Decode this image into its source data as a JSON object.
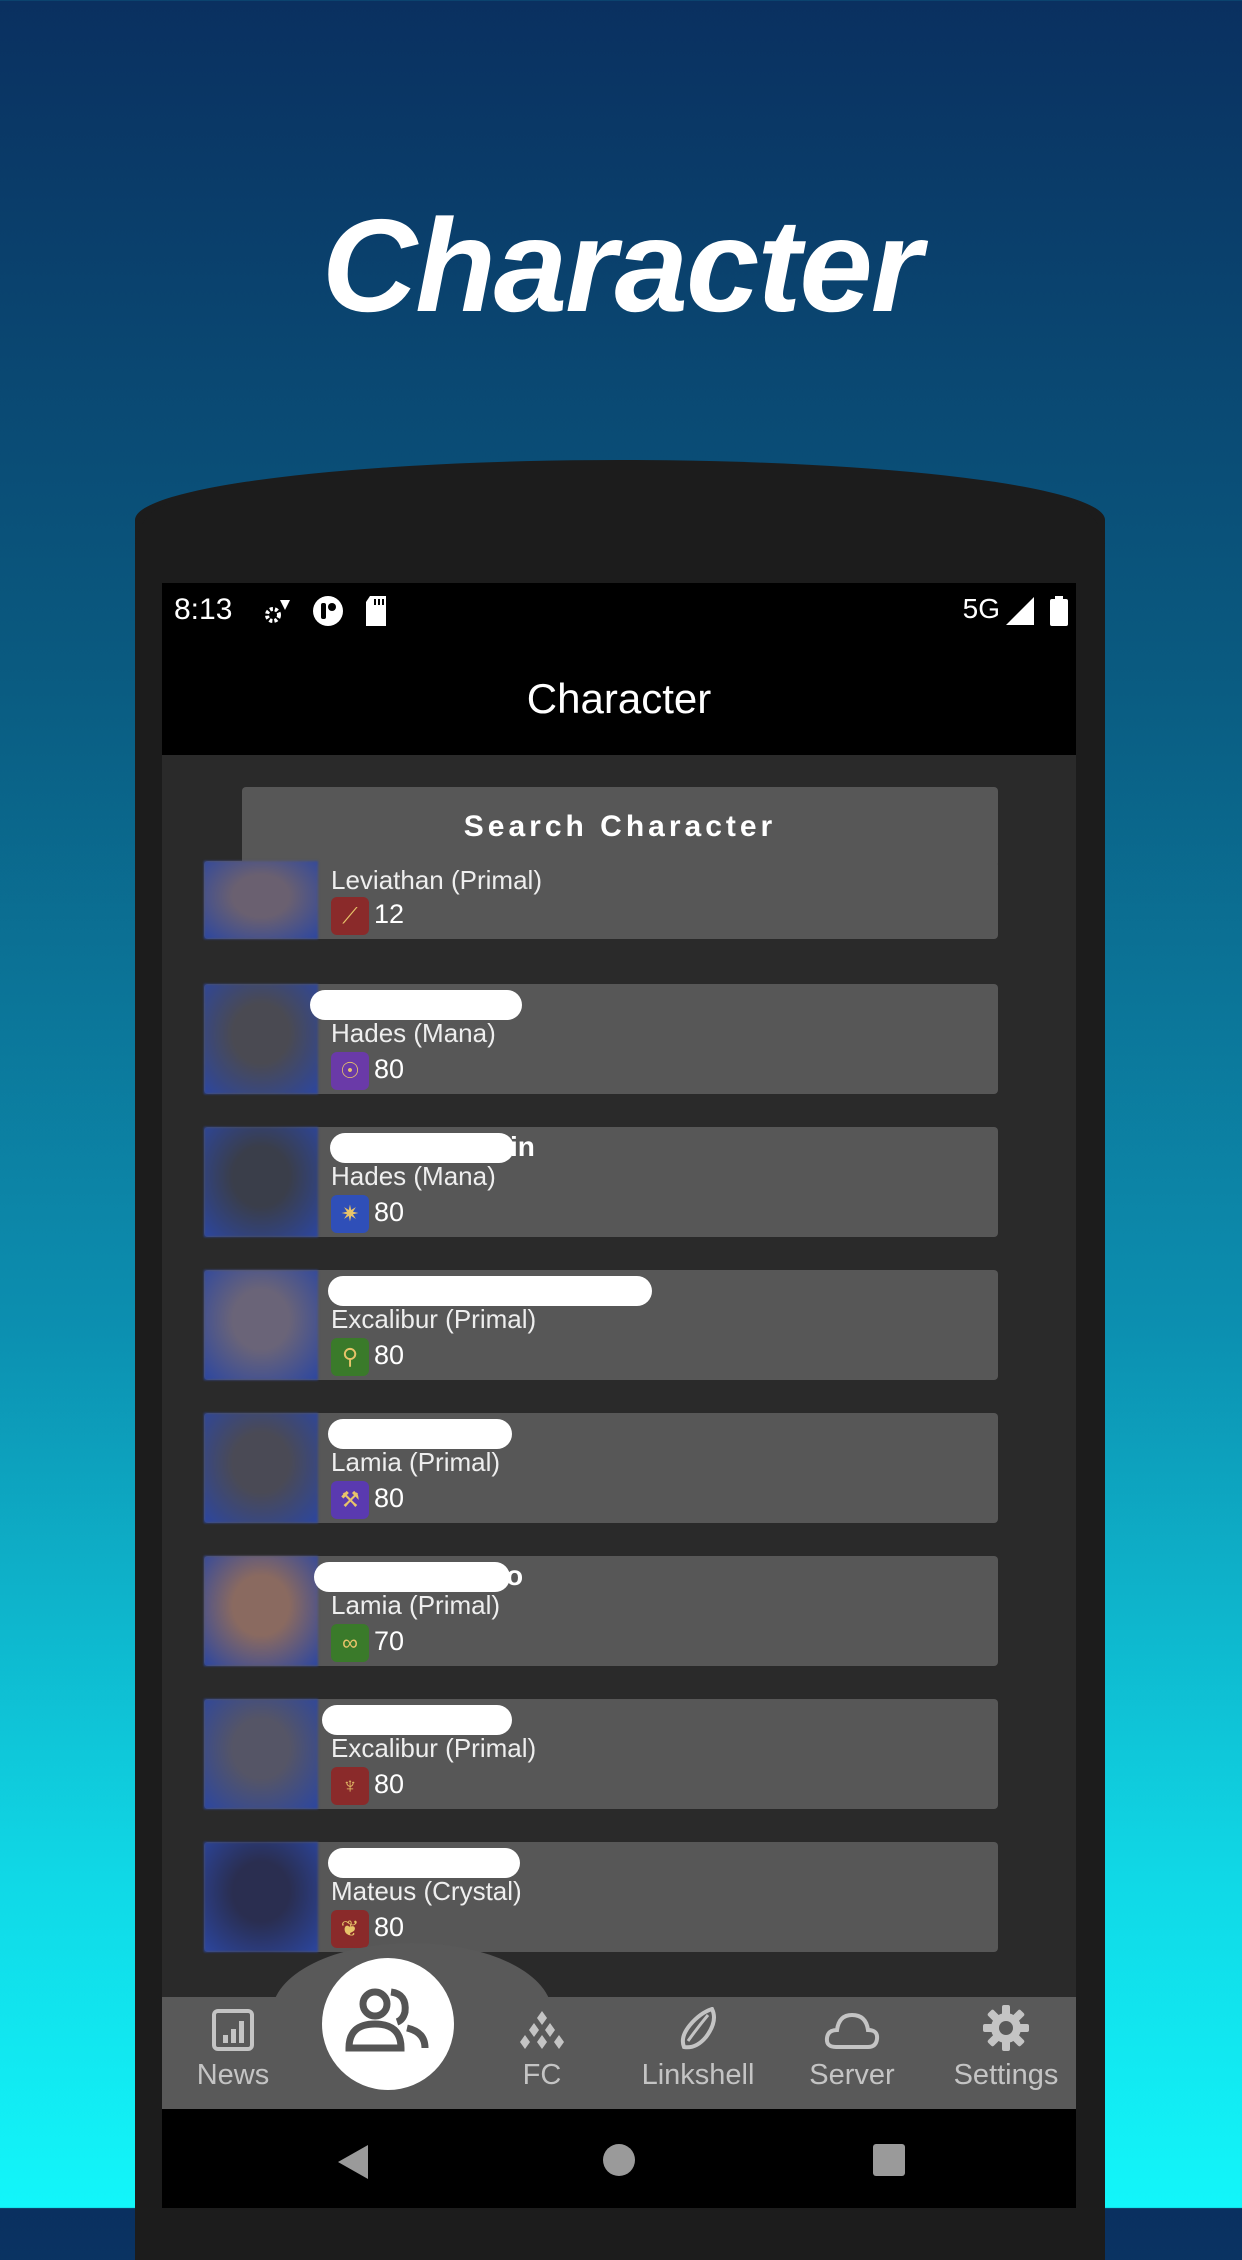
{
  "promo": {
    "title": "Character"
  },
  "status_bar": {
    "time": "8:13",
    "network": "5G"
  },
  "app_bar": {
    "title": "Character"
  },
  "search_button": {
    "label": "Search Character"
  },
  "characters": [
    {
      "name_visible": "",
      "server": "Leviathan (Primal)",
      "job_icon": "lancer-icon",
      "job_color": "#8a2a2a",
      "job_glyph": "⟋",
      "level": "12",
      "avatar_color": "#6a6070"
    },
    {
      "name_visible": "",
      "server": "Hades (Mana)",
      "job_icon": "summoner-icon",
      "job_color": "#6a3aa8",
      "job_glyph": "☉",
      "level": "80",
      "avatar_color": "#4a4a52"
    },
    {
      "name_visible": "in",
      "server": "Hades (Mana)",
      "job_icon": "astrologian-icon",
      "job_color": "#2f4fb8",
      "job_glyph": "✷",
      "level": "80",
      "avatar_color": "#3a3e4a"
    },
    {
      "name_visible": "",
      "server": "Excalibur (Primal)",
      "job_icon": "conjurer-icon",
      "job_color": "#3a7a2a",
      "job_glyph": "⚲",
      "level": "80",
      "avatar_color": "#6a6478"
    },
    {
      "name_visible": "",
      "server": "Lamia (Primal)",
      "job_icon": "blacksmith-icon",
      "job_color": "#5a3ab0",
      "job_glyph": "⚒",
      "level": "80",
      "avatar_color": "#4a4a55"
    },
    {
      "name_visible": "o",
      "server": "Lamia (Primal)",
      "job_icon": "botanist-icon",
      "job_color": "#3a7a2a",
      "job_glyph": "∞",
      "level": "70",
      "avatar_color": "#8a6a60"
    },
    {
      "name_visible": "",
      "server": "Excalibur (Primal)",
      "job_icon": "dragoon-icon",
      "job_color": "#8a2a2a",
      "job_glyph": "♆",
      "level": "80",
      "avatar_color": "#555566"
    },
    {
      "name_visible": "",
      "server": "Mateus (Crystal)",
      "job_icon": "red-mage-icon",
      "job_color": "#8a2a2a",
      "job_glyph": "❦",
      "level": "80",
      "avatar_color": "#2a2e50"
    }
  ],
  "bottom_nav": {
    "items": [
      {
        "label": "News",
        "icon": "chart-icon"
      },
      {
        "label": "",
        "icon": "people-icon",
        "active": true
      },
      {
        "label": "FC",
        "icon": "diamonds-icon"
      },
      {
        "label": "Linkshell",
        "icon": "shell-icon"
      },
      {
        "label": "Server",
        "icon": "cloud-icon"
      },
      {
        "label": "Settings",
        "icon": "gear-icon"
      }
    ]
  }
}
